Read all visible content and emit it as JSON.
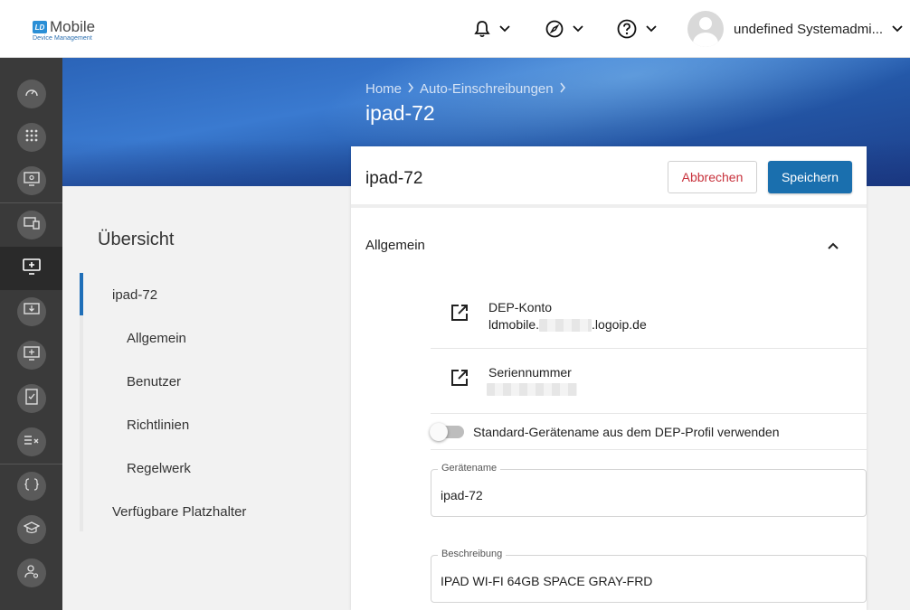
{
  "app": {
    "logo_text": "Mobile",
    "logo_mark": "LD",
    "logo_sub": "Device Management"
  },
  "header": {
    "user_name": "undefined Systemadmi..."
  },
  "breadcrumb": [
    "Home",
    "Auto-Einschreibungen"
  ],
  "page_title": "ipad-72",
  "nav": {
    "title": "Übersicht",
    "items": [
      {
        "label": "ipad-72"
      },
      {
        "label": "Allgemein"
      },
      {
        "label": "Benutzer"
      },
      {
        "label": "Richtlinien"
      },
      {
        "label": "Regelwerk"
      },
      {
        "label": "Verfügbare Platzhalter"
      }
    ]
  },
  "card": {
    "title": "ipad-72",
    "cancel_label": "Abbrechen",
    "save_label": "Speichern",
    "section_title": "Allgemein",
    "dep_account_label": "DEP-Konto",
    "dep_account_prefix": "ldmobile.",
    "dep_account_suffix": ".logoip.de",
    "serial_label": "Seriennummer",
    "toggle_label": "Standard-Gerätename aus dem DEP-Profil verwenden",
    "device_name_label": "Gerätename",
    "device_name_value": "ipad-72",
    "description_label": "Beschreibung",
    "description_value": "IPAD WI-FI 64GB SPACE GRAY-FRD"
  },
  "colors": {
    "accent": "#1a6fae",
    "cancel": "#c8323c",
    "sidebar": "#3a3a3a"
  }
}
